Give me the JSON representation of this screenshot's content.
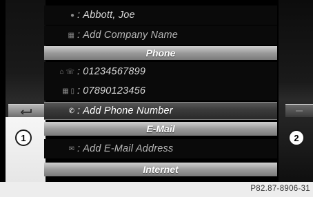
{
  "entries": {
    "name": "Abbott, Joe",
    "company": "Add Company Name",
    "phone_header": "Phone",
    "phone1": "01234567899",
    "phone2": "07890123456",
    "add_phone": "Add Phone Number",
    "email_header": "E-Mail",
    "add_email": "Add E-Mail Address",
    "internet_header": "Internet"
  },
  "separator": ":",
  "callouts": [
    "1",
    "2"
  ],
  "reference": "P82.87-8906-31",
  "icons": {
    "name": "person-icon",
    "company": "building-icon",
    "phone1": "home-phone-icon",
    "phone2": "business-mobile-icon",
    "add_phone": "phone-handset-icon",
    "add_email": "email-icon",
    "back": "back-arrow-icon",
    "right": "arrow-right-icon"
  }
}
